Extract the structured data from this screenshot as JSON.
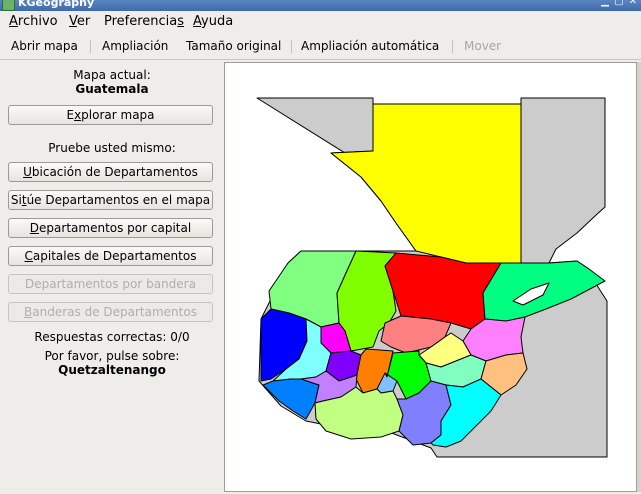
{
  "window": {
    "title": "KGeography"
  },
  "menubar": {
    "items": [
      {
        "label": "Archivo",
        "mnemonic": "A",
        "rest": "rchivo"
      },
      {
        "label": "Ver",
        "mnemonic": "V",
        "rest": "er"
      },
      {
        "label": "Preferencias",
        "mnemonic_pos": "Preferencia",
        "last": "s"
      },
      {
        "label": "Ayuda",
        "mnemonic": "A",
        "rest": "yuda"
      }
    ]
  },
  "toolbar": {
    "open_map": "Abrir mapa",
    "zoom": "Ampliación",
    "original_size": "Tamaño original",
    "auto_zoom": "Ampliación automática",
    "move": "Mover"
  },
  "panel": {
    "current_map_label": "Mapa actual:",
    "current_map": "Guatemala",
    "explore_button": {
      "pre": "E",
      "u": "x",
      "post": "plorar mapa"
    },
    "test_yourself_label": "Pruebe usted mismo:",
    "quiz_buttons": [
      {
        "pre": "",
        "u": "U",
        "post": "bicación de Departamentos",
        "enabled": true
      },
      {
        "pre": "Si",
        "u": "t",
        "post": "úe Departamentos en el mapa",
        "enabled": true
      },
      {
        "pre": "",
        "u": "D",
        "post": "epartamentos por capital",
        "enabled": true
      },
      {
        "pre": "",
        "u": "C",
        "post": "apitales de Departamentos",
        "enabled": true
      },
      {
        "pre": "Departamentos por bandera",
        "u": "",
        "post": "",
        "enabled": false
      },
      {
        "pre": "",
        "u": "B",
        "post": "anderas de Departamentos",
        "enabled": false
      }
    ],
    "correct_answers": "Respuestas correctas: 0/0",
    "prompt_label": "Por favor, pulse sobre:",
    "prompt_target": "Quetzaltenango"
  },
  "colors": {
    "background_gray": "#cccccc",
    "peten": "#ffff00",
    "alta_verapaz": "#ff0000",
    "izabal": "#00ff80",
    "huehuetenango": "#80ff80",
    "quiche": "#80ff00",
    "san_marcos": "#0000ff",
    "totonicapan": "#ff00ff",
    "quetzaltenango": "#80ffff",
    "solola": "#8000ff",
    "chimaltenango": "#ff8000",
    "sacatepequez": "#80c0ff",
    "guatemala": "#00ff00",
    "baja_verapaz": "#ff8080",
    "el_progreso": "#ffff80",
    "zacapa": "#ff80ff",
    "chiquimula": "#ffc080",
    "jalapa": "#80ffc0",
    "jutiapa": "#00ffff",
    "santa_rosa": "#8080ff",
    "escuintla": "#c0ff80",
    "suchitepequez": "#c080ff",
    "retalhuleu": "#0080ff"
  }
}
